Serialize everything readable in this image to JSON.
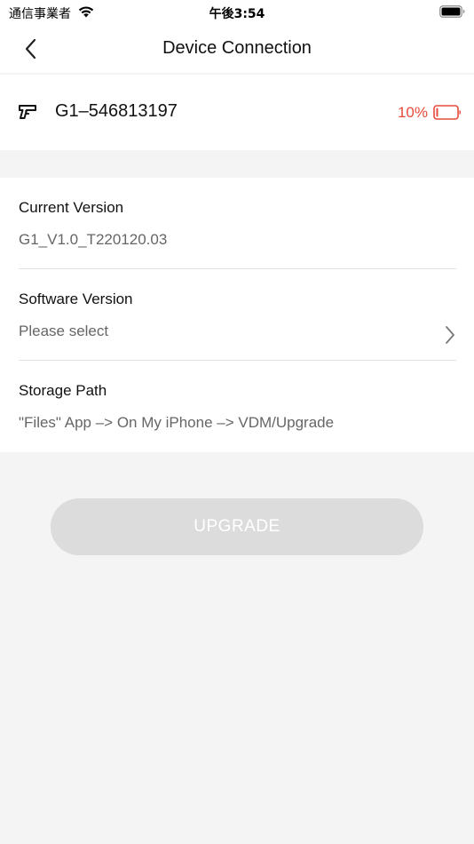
{
  "status_bar": {
    "carrier": "通信事業者",
    "time": "午後3:54",
    "wifi_icon": "wifi-icon",
    "battery_icon": "battery-icon"
  },
  "nav": {
    "back_icon": "chevron-left-icon",
    "title": "Device Connection"
  },
  "device": {
    "icon": "pistol-icon",
    "name": "G1–546813197",
    "battery_percent": "10%",
    "battery_level": 0.1,
    "battery_color": "#e84a3c"
  },
  "info": {
    "current_version": {
      "label": "Current Version",
      "value": "G1_V1.0_T220120.03"
    },
    "software_version": {
      "label": "Software Version",
      "value": "Please select",
      "chevron_icon": "chevron-right-icon"
    },
    "storage_path": {
      "label": "Storage Path",
      "value": "\"Files\" App –> On My iPhone –> VDM/Upgrade"
    }
  },
  "actions": {
    "upgrade_label": "UPGRADE",
    "upgrade_enabled": false
  },
  "colors": {
    "background": "#f4f4f4",
    "card": "#ffffff",
    "accent_warning": "#e84a3c",
    "button_disabled": "#dcdcdc"
  }
}
